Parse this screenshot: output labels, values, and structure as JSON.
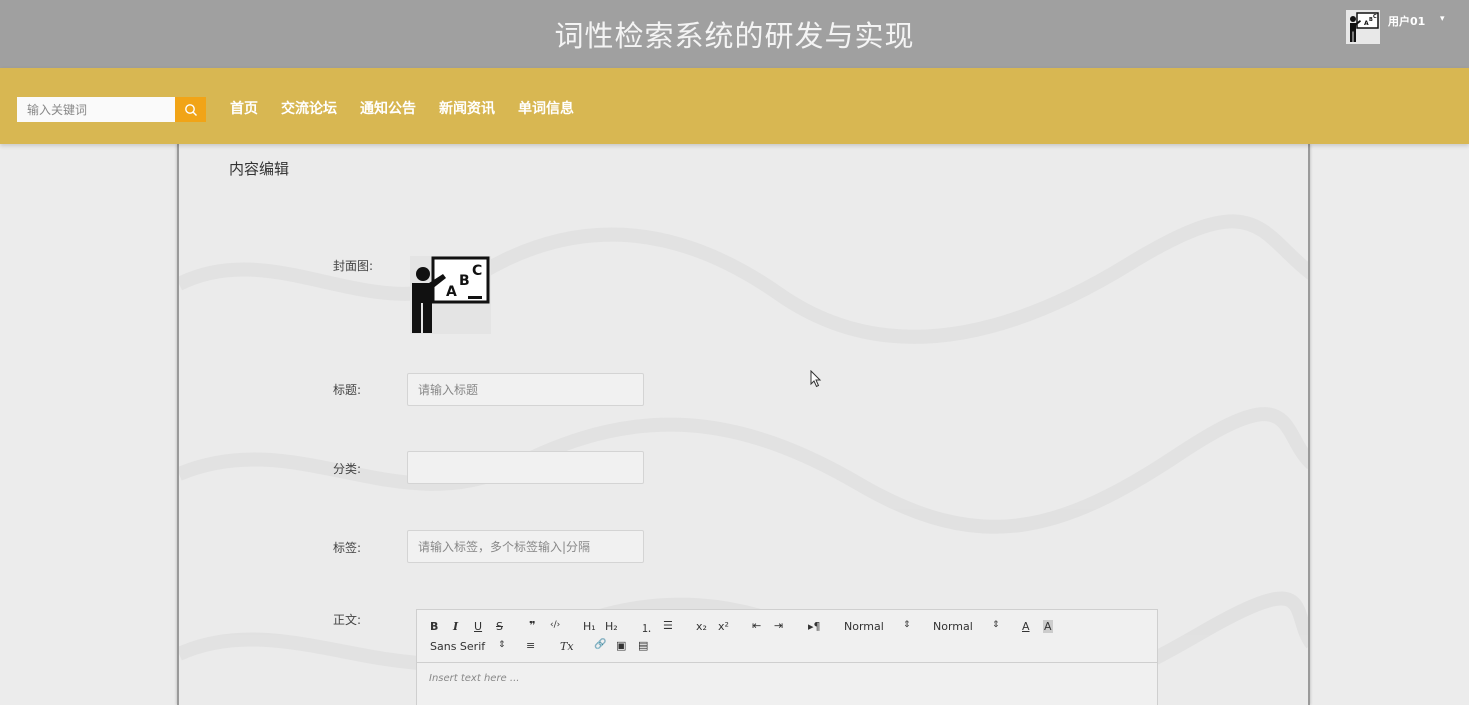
{
  "header": {
    "title": "词性检索系统的研发与实现",
    "user": {
      "name": "用户01",
      "caret": "▾"
    }
  },
  "navbar": {
    "search": {
      "placeholder": "输入关键词"
    },
    "links": [
      "首页",
      "交流论坛",
      "通知公告",
      "新闻资讯",
      "单词信息"
    ]
  },
  "form": {
    "section_title": "内容编辑",
    "cover": {
      "label": "封面图:",
      "image_letters": [
        "A",
        "B",
        "C"
      ]
    },
    "title": {
      "label": "标题:",
      "placeholder": "请输入标题"
    },
    "category": {
      "label": "分类:",
      "value": ""
    },
    "tags": {
      "label": "标签:",
      "placeholder": "请输入标签，多个标签输入|分隔"
    },
    "body": {
      "label": "正文:",
      "toolbar": {
        "bold": "B",
        "italic": "I",
        "underline": "U",
        "strike": "S",
        "blockquote": "❞",
        "code": "‹/›",
        "h1": "H₁",
        "h2": "H₂",
        "ordered_list": "⒈",
        "bullet_list": "☰",
        "subscript": "x₂",
        "superscript": "x²",
        "outdent": "⇤",
        "indent": "⇥",
        "direction": "▸¶",
        "size_select": "Normal",
        "header_select": "Normal",
        "select_caret": "⇕",
        "color": "A",
        "background": "A",
        "font_select": "Sans Serif",
        "align": "≡",
        "clean": "Tx",
        "link": "🔗",
        "image": "▣",
        "video": "▤"
      },
      "placeholder": "Insert text here ..."
    }
  }
}
